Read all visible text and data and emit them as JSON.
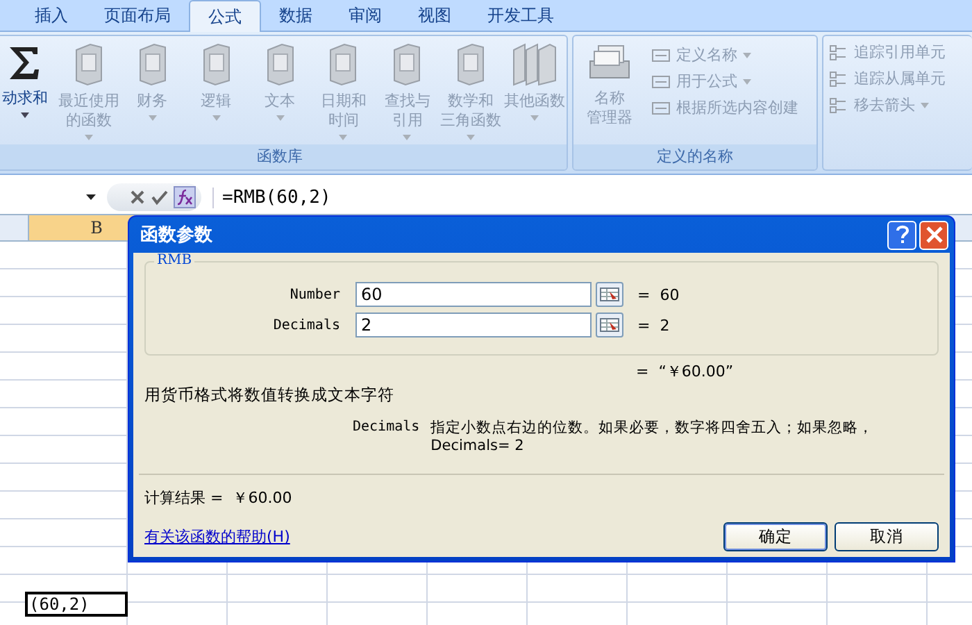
{
  "ribbon": {
    "tabs": [
      {
        "label": "插入",
        "selected": false
      },
      {
        "label": "页面布局",
        "selected": false
      },
      {
        "label": "公式",
        "selected": true
      },
      {
        "label": "数据",
        "selected": false
      },
      {
        "label": "审阅",
        "selected": false
      },
      {
        "label": "视图",
        "selected": false
      },
      {
        "label": "开发工具",
        "selected": false
      }
    ],
    "function_library": {
      "label": "函数库",
      "buttons": [
        {
          "label_lines": [
            "动求和"
          ],
          "disabled": false,
          "dropdown": true
        },
        {
          "label_lines": [
            "最近使用",
            "的函数"
          ],
          "disabled": true,
          "dropdown": true
        },
        {
          "label_lines": [
            "财务"
          ],
          "disabled": true,
          "dropdown": true
        },
        {
          "label_lines": [
            "逻辑"
          ],
          "disabled": true,
          "dropdown": true
        },
        {
          "label_lines": [
            "文本"
          ],
          "disabled": true,
          "dropdown": true
        },
        {
          "label_lines": [
            "日期和",
            "时间"
          ],
          "disabled": true,
          "dropdown": true
        },
        {
          "label_lines": [
            "查找与",
            "引用"
          ],
          "disabled": true,
          "dropdown": true
        },
        {
          "label_lines": [
            "数学和",
            "三角函数"
          ],
          "disabled": true,
          "dropdown": true
        },
        {
          "label_lines": [
            "其他函数"
          ],
          "disabled": true,
          "dropdown": true
        }
      ]
    },
    "defined_names": {
      "label": "定义的名称",
      "manager": {
        "label_lines": [
          "名称",
          "管理器"
        ]
      },
      "items": [
        {
          "label": "定义名称",
          "dropdown": true
        },
        {
          "label": "用于公式",
          "dropdown": true
        },
        {
          "label": "根据所选内容创建",
          "dropdown": false
        }
      ]
    },
    "auditing": {
      "items": [
        {
          "label": "追踪引用单元",
          "dropdown": false
        },
        {
          "label": "追踪从属单元",
          "dropdown": false
        },
        {
          "label": "移去箭头",
          "dropdown": true
        }
      ]
    }
  },
  "formula_bar": {
    "formula": "=RMB(60,2)"
  },
  "sheet": {
    "column_header": "B",
    "active_cell": "(60,2)"
  },
  "dialog": {
    "title": "函数参数",
    "function_name": "RMB",
    "arguments": [
      {
        "name": "Number",
        "value": "60",
        "result": "=  60"
      },
      {
        "name": "Decimals",
        "value": "2",
        "result": "=  2"
      }
    ],
    "formula_result": "=  “￥60.00”",
    "description": "用货币格式将数值转换成文本字符",
    "argument_help": {
      "name": "Decimals",
      "text": "指定小数点右边的位数。如果必要，数字将四舍五入；如果忽略，\nDecimals= 2"
    },
    "calculation_result": "计算结果 =  ￥60.00",
    "help_link": "有关该函数的帮助(H)",
    "buttons": [
      "确定",
      "取消"
    ]
  }
}
